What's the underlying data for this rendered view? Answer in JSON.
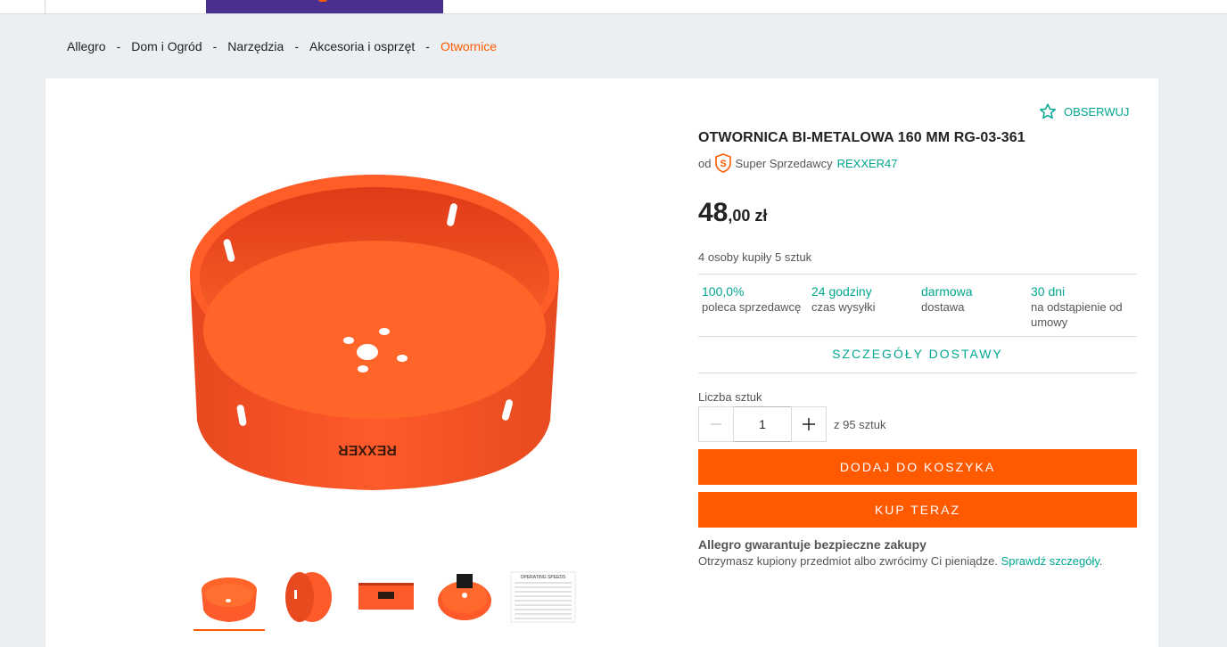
{
  "breadcrumb": {
    "items": [
      "Allegro",
      "Dom i Ogród",
      "Narzędzia",
      "Akcesoria i osprzęt",
      "Otwornice"
    ],
    "separator": "-"
  },
  "product": {
    "watch_label": "OBSERWUJ",
    "title": "OTWORNICA BI-METALOWA 160 MM RG-03-361",
    "seller_prefix": "od",
    "seller_badge": "Super Sprzedawcy",
    "seller_name": "REXXER47",
    "price_int": "48",
    "price_frac": ",00 zł",
    "bought": "4 osoby kupiły 5 sztuk",
    "brand_mark": "REXXER"
  },
  "stats": [
    {
      "value": "100,0%",
      "label": "poleca sprzedawcę"
    },
    {
      "value": "24 godziny",
      "label": "czas wysyłki"
    },
    {
      "value": "darmowa",
      "label": "dostawa"
    },
    {
      "value": "30 dni",
      "label": "na odstąpienie od umowy"
    }
  ],
  "delivery_details": "SZCZEGÓŁY DOSTAWY",
  "quantity": {
    "label": "Liczba sztuk",
    "value": "1",
    "of_text": "z 95 sztuk"
  },
  "actions": {
    "add_to_cart": "DODAJ DO KOSZYKA",
    "buy_now": "KUP TERAZ"
  },
  "guarantee": {
    "title": "Allegro gwarantuje bezpieczne zakupy",
    "text": "Otrzymasz kupiony przedmiot albo zwrócimy Ci pieniądze. ",
    "link": "Sprawdź szczegóły"
  },
  "thumb_chart_title": "OPERATING SPEEDS",
  "colors": {
    "accent": "#ff5a00",
    "link": "#00a790",
    "promo": "#4a2f8f"
  }
}
